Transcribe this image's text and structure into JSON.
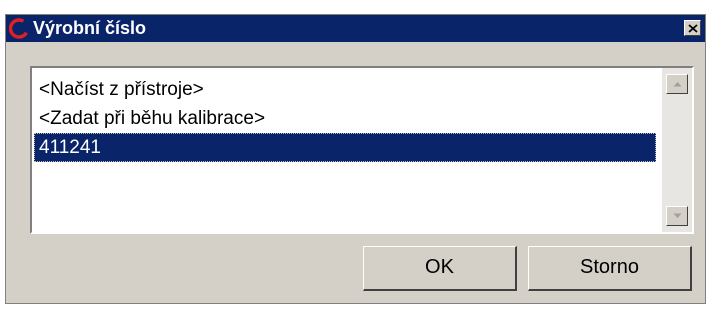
{
  "window": {
    "title": "Výrobní číslo",
    "close_label": "×"
  },
  "serial_list": {
    "items": [
      {
        "label": "<Načíst z přístroje>",
        "selected": false
      },
      {
        "label": "<Zadat při běhu kalibrace>",
        "selected": false
      },
      {
        "label": "411241",
        "selected": true
      }
    ]
  },
  "buttons": {
    "ok_label": "OK",
    "cancel_label": "Storno"
  },
  "colors": {
    "titlebar": "#0a246a",
    "selection": "#0a246a",
    "app_icon": "#e02020",
    "face": "#d4d0c8"
  },
  "icons": {
    "app": "app-logo-icon",
    "close": "close-icon",
    "scroll_up": "scroll-up-arrow-icon",
    "scroll_down": "scroll-down-arrow-icon"
  }
}
